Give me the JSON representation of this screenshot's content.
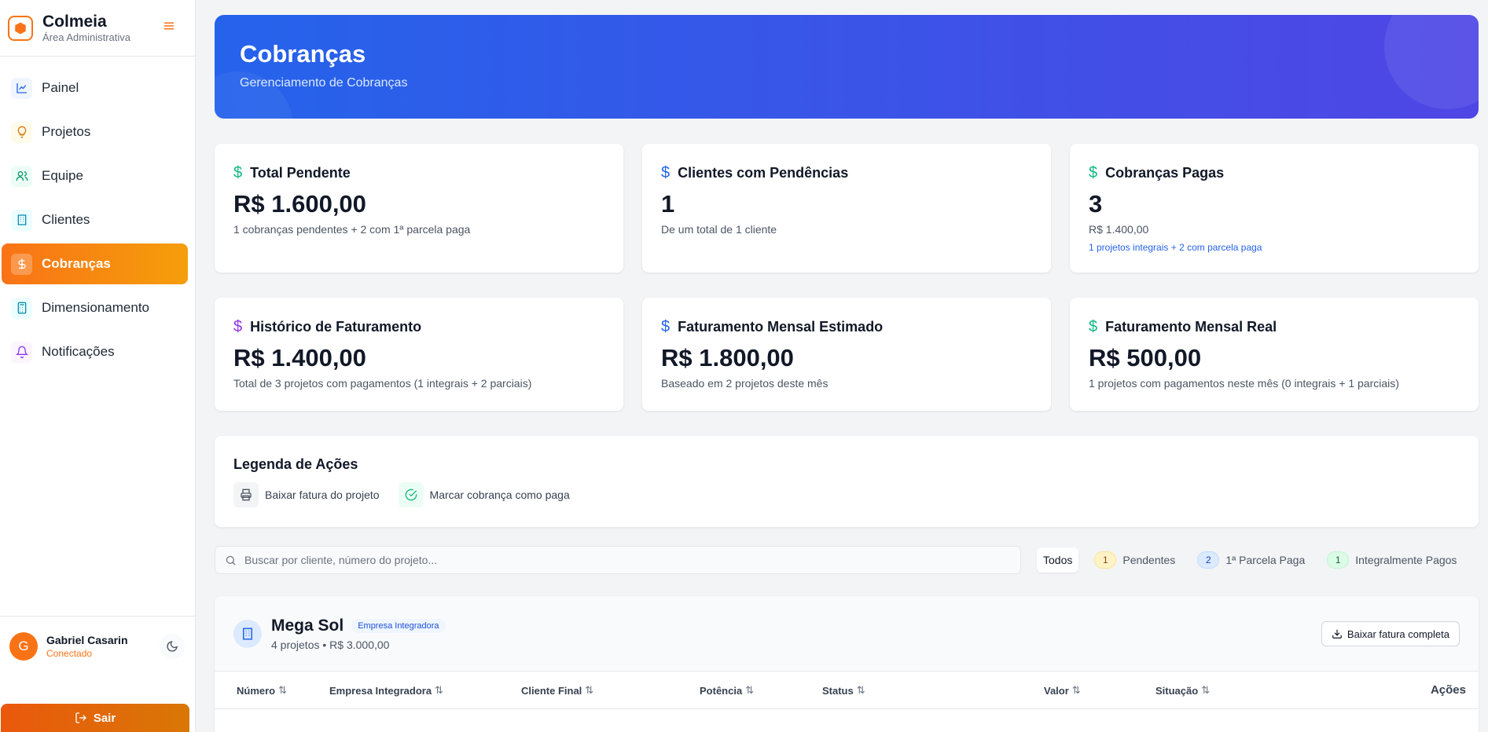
{
  "brand": {
    "name": "Colmeia",
    "subtitle": "Área Administrativa"
  },
  "nav": [
    {
      "label": "Painel",
      "icon": "chart-line-icon",
      "color": "#2563eb"
    },
    {
      "label": "Projetos",
      "icon": "lightbulb-icon",
      "color": "#d97706"
    },
    {
      "label": "Equipe",
      "icon": "users-icon",
      "color": "#059669"
    },
    {
      "label": "Clientes",
      "icon": "building-icon",
      "color": "#0891b2"
    },
    {
      "label": "Cobranças",
      "icon": "dollar-icon",
      "color": "#ffffff",
      "active": true
    },
    {
      "label": "Dimensionamento",
      "icon": "calculator-icon",
      "color": "#0891b2"
    },
    {
      "label": "Notificações",
      "icon": "bell-icon",
      "color": "#9333ea"
    }
  ],
  "user": {
    "name": "Gabriel Casarin",
    "status": "Conectado",
    "initial": "G"
  },
  "logout_label": "Sair",
  "hero": {
    "title": "Cobranças",
    "subtitle": "Gerenciamento de Cobranças"
  },
  "cards": {
    "total_pendente": {
      "title": "Total Pendente",
      "value": "R$ 1.600,00",
      "sub": "1 cobranças pendentes + 2 com 1ª parcela paga"
    },
    "clientes_pendencias": {
      "title": "Clientes com Pendências",
      "value": "1",
      "sub": "De um total de 1 cliente"
    },
    "cobrancas_pagas": {
      "title": "Cobranças Pagas",
      "value": "3",
      "sub": "R$ 1.400,00",
      "sub2": "1 projetos integrais + 2 com parcela paga"
    },
    "historico": {
      "title": "Histórico de Faturamento",
      "value": "R$ 1.400,00",
      "sub": "Total de 3 projetos com pagamentos (1 integrais + 2 parciais)"
    },
    "mensal_estimado": {
      "title": "Faturamento Mensal Estimado",
      "value": "R$ 1.800,00",
      "sub": "Baseado em 2 projetos deste mês"
    },
    "mensal_real": {
      "title": "Faturamento Mensal Real",
      "value": "R$ 500,00",
      "sub": "1 projetos com pagamentos neste mês (0 integrais + 1 parciais)"
    }
  },
  "legend": {
    "title": "Legenda de Ações",
    "items": [
      "Baixar fatura do projeto",
      "Marcar cobrança como paga"
    ]
  },
  "search": {
    "placeholder": "Buscar por cliente, número do projeto..."
  },
  "tabs": [
    {
      "label": "Todos",
      "count": ""
    },
    {
      "label": "Pendentes",
      "count": "1"
    },
    {
      "label": "1ª Parcela Paga",
      "count": "2"
    },
    {
      "label": "Integralmente Pagos",
      "count": "1"
    }
  ],
  "client": {
    "name": "Mega Sol",
    "tag": "Empresa Integradora",
    "meta": "4 projetos • R$ 3.000,00",
    "download_label": "Baixar fatura completa"
  },
  "table_headers": [
    "Número",
    "Empresa Integradora",
    "Cliente Final",
    "Potência",
    "Status",
    "Valor",
    "Situação",
    "Ações"
  ],
  "colors": {
    "accent": "#f97316",
    "primary": "#2563eb",
    "green": "#10b981",
    "purple": "#9333ea"
  }
}
